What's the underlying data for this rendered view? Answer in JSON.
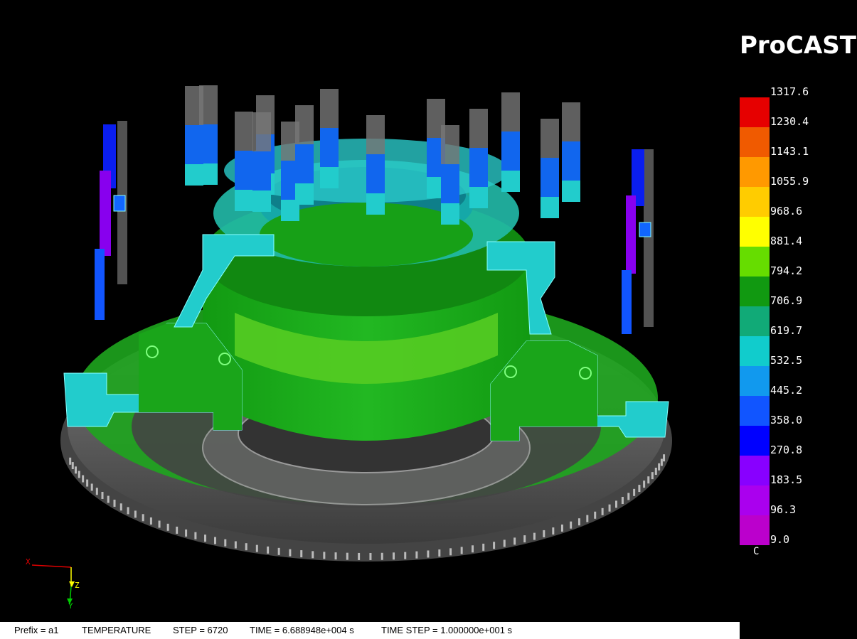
{
  "brand": "ProCAST",
  "legend": {
    "unit": "C",
    "values": [
      "1317.6",
      "1230.4",
      "1143.1",
      "1055.9",
      "968.6",
      "881.4",
      "794.2",
      "706.9",
      "619.7",
      "532.5",
      "445.2",
      "358.0",
      "270.8",
      "183.5",
      "96.3",
      "9.0"
    ],
    "colors": [
      "#e60000",
      "#f05a00",
      "#ff9900",
      "#ffcc00",
      "#ffff00",
      "#66dd00",
      "#119911",
      "#11aa77",
      "#11cccc",
      "#1199ee",
      "#1155ff",
      "#0000ff",
      "#8800ff",
      "#aa00ee",
      "#bb00cc"
    ]
  },
  "axes": {
    "x": "X",
    "y": "Y",
    "z": "Z"
  },
  "status": {
    "prefix": "Prefix = a1",
    "field": "TEMPERATURE",
    "step": "STEP = 6720",
    "time": "TIME = 6.688948e+004 s",
    "time_step": "TIME STEP = 1.000000e+001 s"
  },
  "colors": {
    "casting_green": "#11aa11",
    "gating_cyan": "#22cccc",
    "riser_blue": "#1166ee",
    "mold_gray": "#777777"
  }
}
